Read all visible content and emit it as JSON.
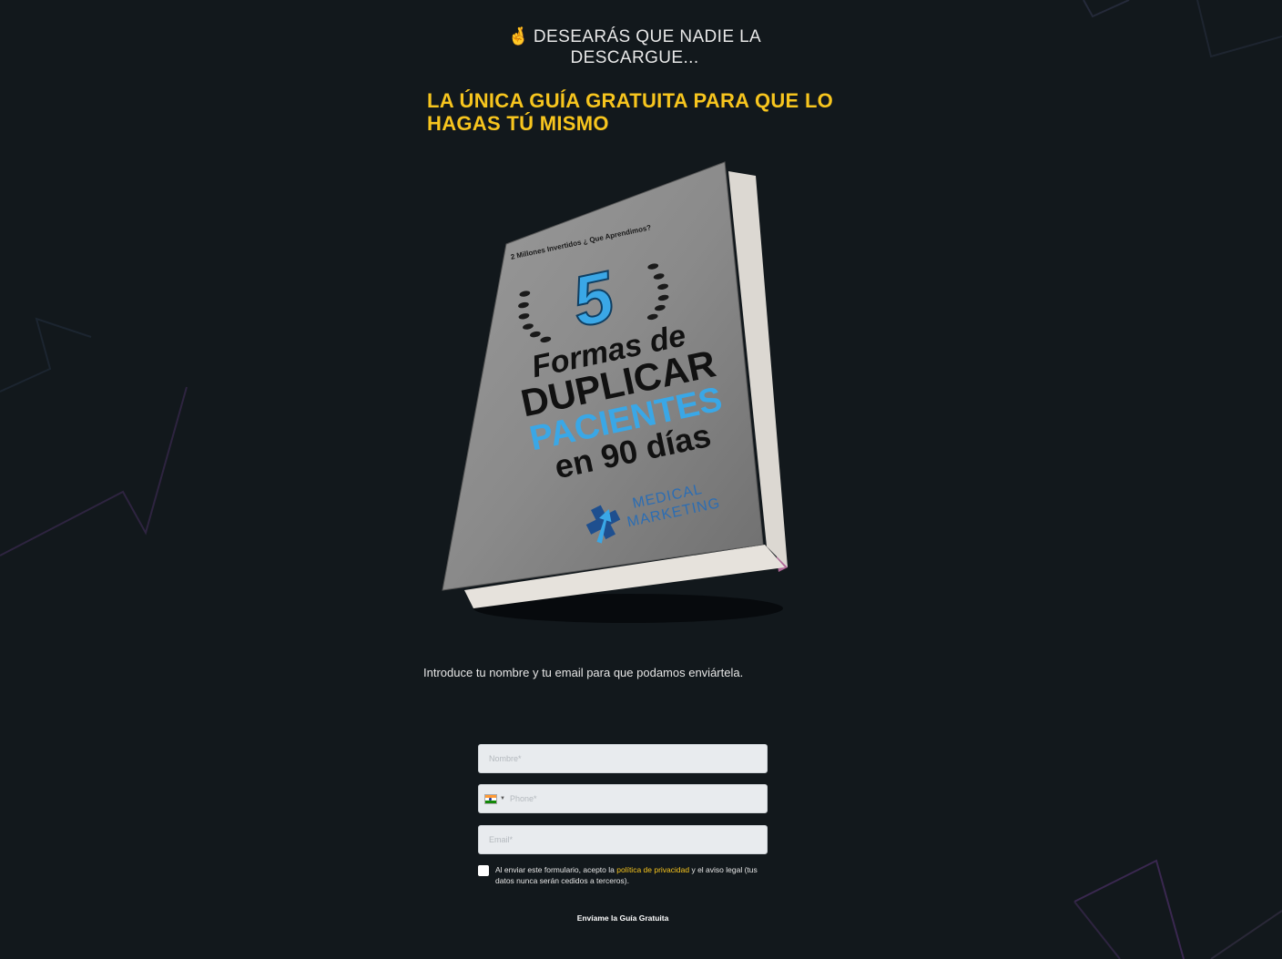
{
  "teaser": {
    "emoji": "🤞",
    "text": "DESEARÁS QUE NADIE LA DESCARGUE..."
  },
  "headline": "LA ÚNICA GUÍA GRATUITA PARA QUE LO HAGAS TÚ MISMO",
  "book": {
    "top_line": "2 Millones Invertidos ¿ Que Aprendimos?",
    "number": "5",
    "line1": "Formas de",
    "line2": "DUPLICAR",
    "line3": "PACIENTES",
    "line4": "en 90 días",
    "brand_line1": "MEDICAL",
    "brand_line2": "MARKETING"
  },
  "form": {
    "instructions": "Introduce tu nombre y tu email para que podamos enviártela.",
    "name_placeholder": "Nombre*",
    "phone_placeholder": "Phone*",
    "email_placeholder": "Email*",
    "consent_before": "Al enviar este formulario, acepto la ",
    "consent_link": "política de privacidad",
    "consent_after": " y el aviso legal (tus datos nunca serán cedidos a terceros).",
    "submit_label": "Envíame la Guía Gratuita"
  },
  "colors": {
    "background": "#12181c",
    "accent": "#f7c51e",
    "book_blue": "#3aa7e6",
    "brand_blue": "#2c6db3"
  }
}
